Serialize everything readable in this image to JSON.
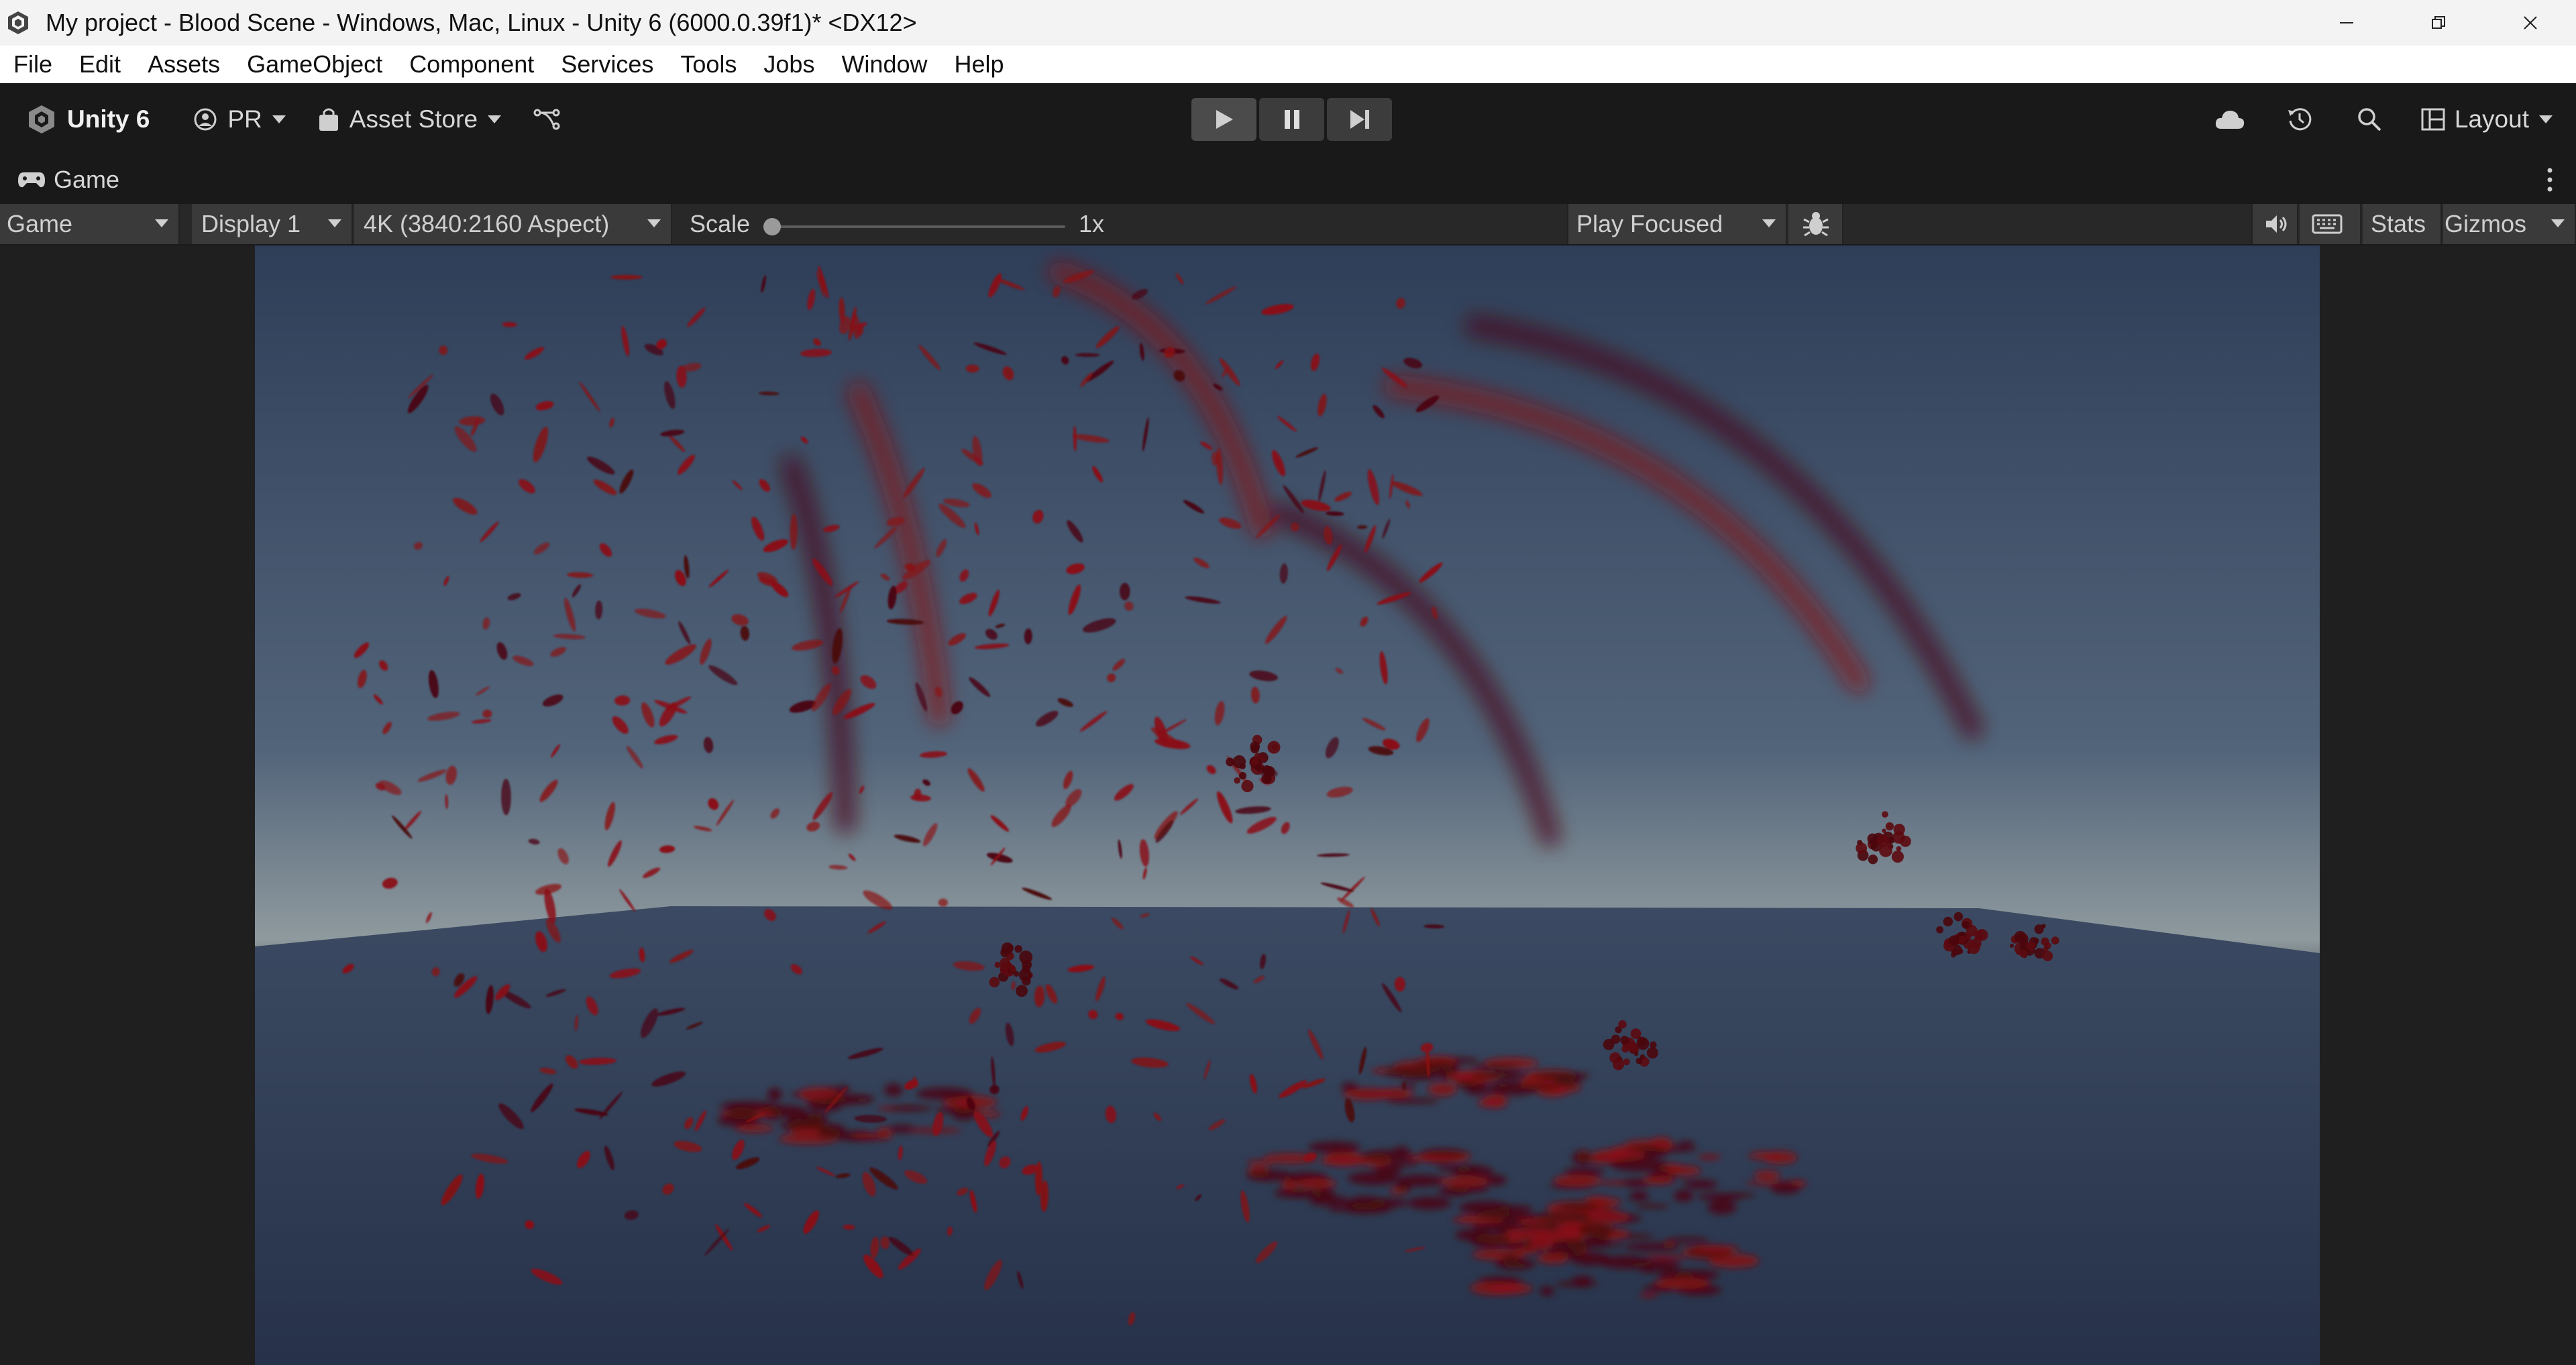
{
  "window": {
    "title": "My project - Blood Scene - Windows, Mac, Linux - Unity 6 (6000.0.39f1)* <DX12>"
  },
  "menu": [
    "File",
    "Edit",
    "Assets",
    "GameObject",
    "Component",
    "Services",
    "Tools",
    "Jobs",
    "Window",
    "Help"
  ],
  "toolbar": {
    "brand": "Unity 6",
    "account": "PR",
    "asset_store": "Asset Store",
    "layout": "Layout"
  },
  "tab": {
    "label": "Game"
  },
  "game_bar": {
    "view": "Game",
    "display": "Display 1",
    "resolution": "4K (3840:2160 Aspect)",
    "scale_label": "Scale",
    "scale_value": "1x",
    "scale_level": 0.0,
    "play_mode": "Play Focused",
    "stats": "Stats",
    "gizmos": "Gizmos"
  },
  "colors": {
    "blood": "#8a0d14",
    "blood_dark": "#4a070c",
    "sky_top": "#33445f",
    "sky_horizon": "#8c979c",
    "ground": "#2e3b52"
  }
}
